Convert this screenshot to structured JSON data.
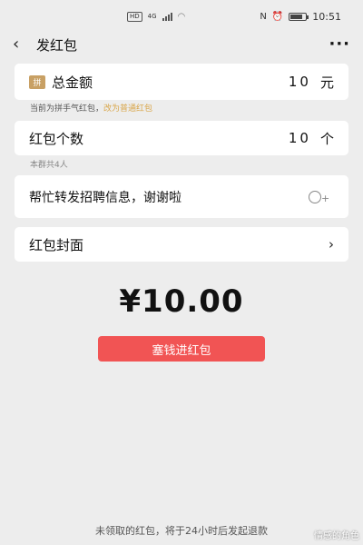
{
  "status_bar": {
    "hd": "HD",
    "network": "4G",
    "time": "10:51",
    "battery_level": 0.8
  },
  "nav": {
    "title": "发红包",
    "back_icon": "chevron-left-icon",
    "more_icon": "more-dots-icon",
    "more_label": "···"
  },
  "amount": {
    "badge": "拼",
    "label": "总金额",
    "value": "10",
    "unit": "元"
  },
  "hint": {
    "text": "当前为拼手气红包，",
    "switch_link": "改为普通红包"
  },
  "count": {
    "label": "红包个数",
    "value": "10",
    "unit": "个"
  },
  "group_hint": "本群共4人",
  "message": {
    "value": "帮忙转发招聘信息，谢谢啦",
    "emoji_icon": "emoji-add-icon"
  },
  "cover": {
    "label": "红包封面",
    "chevron": "›"
  },
  "total_display": "¥10.00",
  "send_button": "塞钱进红包",
  "footer_note": "未领取的红包，将于24小时后发起退款",
  "watermark": "情感的角色",
  "colors": {
    "accent_red": "#f15454",
    "link_gold": "#d9a64a",
    "badge_gold": "#c8a064",
    "background": "#ededed"
  }
}
